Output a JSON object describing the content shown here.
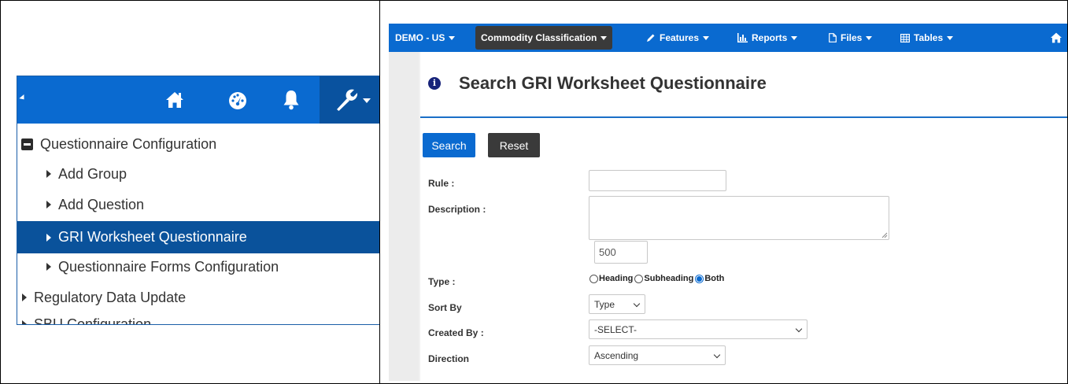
{
  "left_panel": {
    "tree": [
      {
        "label": "Questionnaire Configuration",
        "kind": "expanded-parent"
      },
      {
        "label": "Add Group",
        "kind": "child"
      },
      {
        "label": "Add Question",
        "kind": "child"
      },
      {
        "label": "GRI Worksheet Questionnaire",
        "kind": "child-selected"
      },
      {
        "label": "Questionnaire Forms Configuration",
        "kind": "child"
      },
      {
        "label": "Regulatory Data Update",
        "kind": "collapsed-parent"
      },
      {
        "label": "SBU Configuration",
        "kind": "collapsed-parent-cut"
      }
    ],
    "icons": [
      "home-icon",
      "dashboard-icon",
      "bell-icon",
      "wrench-icon"
    ]
  },
  "navbar": {
    "company": "DEMO - US",
    "active_module": "Commodity Classification",
    "features": "Features",
    "reports": "Reports",
    "files": "Files",
    "tables": "Tables"
  },
  "page": {
    "title": "Search GRI Worksheet Questionnaire",
    "search_label": "Search",
    "reset_label": "Reset"
  },
  "form": {
    "rule_label": "Rule :",
    "rule_value": "",
    "description_label": "Description :",
    "description_value": "",
    "char_counter": "500",
    "type_label": "Type :",
    "type_options": [
      "Heading",
      "Subheading",
      "Both"
    ],
    "type_selected": "Both",
    "sort_by_label": "Sort By",
    "sort_by_value": "Type",
    "created_by_label": "Created By :",
    "created_by_value": "-SELECT-",
    "direction_label": "Direction",
    "direction_value": "Ascending"
  },
  "colors": {
    "primary_blue": "#0a6ad0",
    "selected_row": "#0a529b",
    "dark_button": "#3a3a3a"
  }
}
